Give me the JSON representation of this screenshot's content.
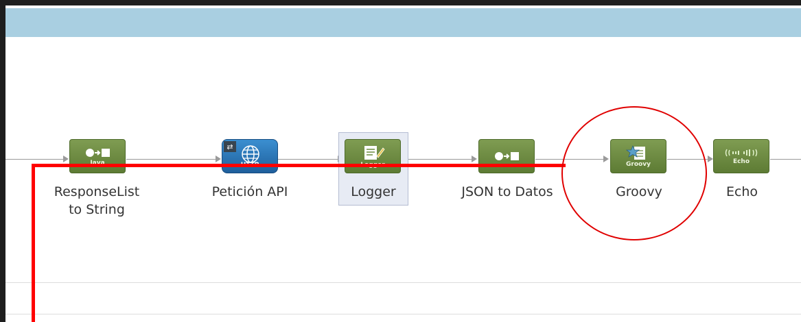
{
  "flow": {
    "nodes": [
      {
        "label": "ResponseList to String",
        "label_line1": "ResponseList",
        "label_line2": "to String",
        "icon": "transform-icon",
        "sub": "Java"
      },
      {
        "label": "Petición API",
        "icon": "http-icon",
        "sub": "HTTP"
      },
      {
        "label": "Logger",
        "icon": "logger-icon",
        "sub": "Logger"
      },
      {
        "label": "JSON to Datos",
        "icon": "transform-icon",
        "sub": ""
      },
      {
        "label": "Groovy",
        "icon": "groovy-icon",
        "sub": "Groovy"
      },
      {
        "label": "Echo",
        "icon": "echo-icon",
        "sub": "Echo"
      }
    ]
  },
  "colors": {
    "header": "#a9cfe1",
    "node_green": "#6a8a3e",
    "http_blue": "#2a77ba",
    "annotation_red": "#ff0000"
  }
}
